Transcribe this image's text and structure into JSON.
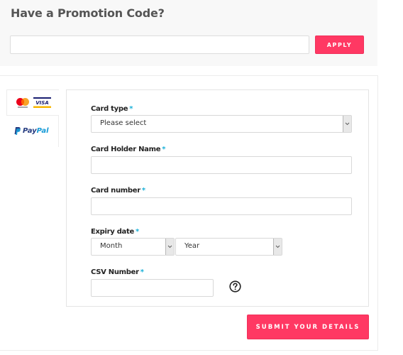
{
  "promo": {
    "title": "Have a Promotion Code?",
    "input_value": "",
    "input_placeholder": "",
    "apply_label": "APPLY"
  },
  "payment_methods": {
    "tabs": [
      {
        "id": "cards",
        "icons": [
          "mastercard-icon",
          "visa-icon"
        ],
        "active": true
      },
      {
        "id": "paypal",
        "label_part1": "Pay",
        "label_part2": "Pal",
        "active": false
      }
    ],
    "visa_text": "VISA"
  },
  "form": {
    "card_type": {
      "label": "Card type",
      "required_mark": "*",
      "selected": "Please select"
    },
    "card_holder": {
      "label": "Card Holder Name",
      "required_mark": "*",
      "value": ""
    },
    "card_number": {
      "label": "Card number",
      "required_mark": "*",
      "value": ""
    },
    "expiry": {
      "label": "Expiry date",
      "required_mark": "*",
      "month_selected": "Month",
      "year_selected": "Year"
    },
    "csv": {
      "label": "CSV Number",
      "required_mark": "*",
      "value": ""
    }
  },
  "submit_label": "SUBMIT YOUR DETAILS",
  "colors": {
    "accent": "#ff3863",
    "required": "#1ab0d8",
    "promo_bg": "#f8f8f8"
  }
}
